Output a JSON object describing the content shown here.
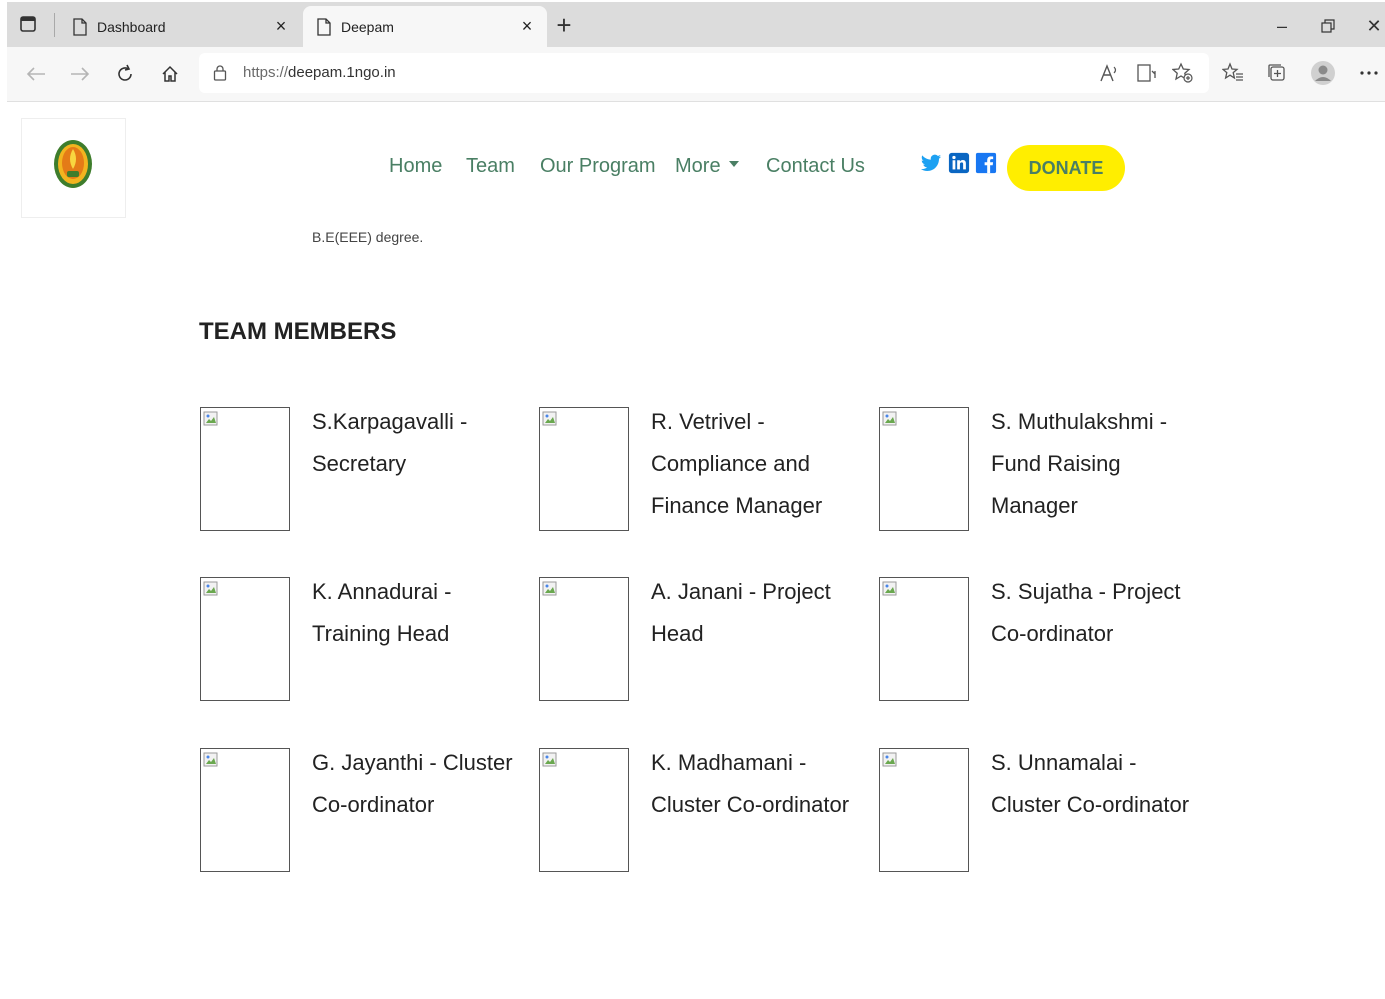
{
  "browser": {
    "tabs": [
      {
        "title": "Dashboard",
        "active": false
      },
      {
        "title": "Deepam",
        "active": true
      }
    ],
    "url": {
      "protocol": "https://",
      "host": "deepam.1ngo.in"
    },
    "icons": [
      "back-icon",
      "forward-icon",
      "refresh-icon",
      "home-icon",
      "lock-icon",
      "read-aloud-icon",
      "immersive-reader-icon",
      "add-favorite-icon",
      "favorites-icon",
      "collections-icon",
      "profile-icon",
      "more-icon"
    ]
  },
  "site": {
    "nav": {
      "home": "Home",
      "team": "Team",
      "program": "Our Program",
      "more": "More",
      "contact": "Contact Us"
    },
    "social": [
      "twitter-icon",
      "linkedin-icon",
      "facebook-icon"
    ],
    "donate_label": "DONATE",
    "colors": {
      "nav_link": "#4a7f64",
      "donate_bg": "#ffee00"
    }
  },
  "content": {
    "cut_text": "B.E(EEE) degree.",
    "section_title": "TEAM MEMBERS",
    "members": [
      {
        "name": "S.Karpagavalli - Secretary"
      },
      {
        "name": "R. Vetrivel - Compliance and Finance Manager"
      },
      {
        "name": "S. Muthulakshmi - Fund Raising Manager"
      },
      {
        "name": "K. Annadurai - Training Head"
      },
      {
        "name": "A. Janani - Project Head"
      },
      {
        "name": "S. Sujatha - Project Co-ordinator"
      },
      {
        "name": "G. Jayanthi - Cluster Co-ordinator"
      },
      {
        "name": "K. Madhamani - Cluster Co-ordinator"
      },
      {
        "name": "S. Unnamalai - Cluster Co-ordinator"
      }
    ]
  }
}
